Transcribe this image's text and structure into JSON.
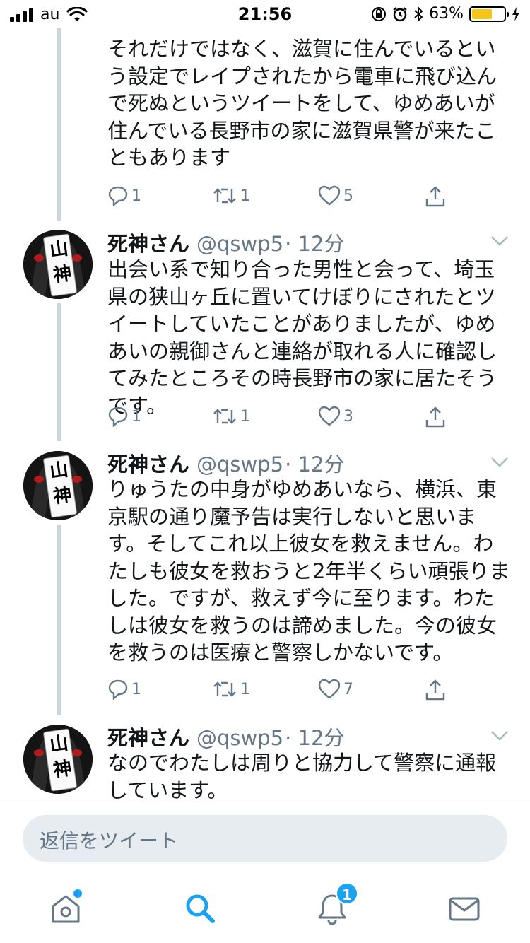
{
  "status_bar": {
    "carrier": "au",
    "time": "21:56",
    "battery_percent": "63%",
    "battery_level": 0.63
  },
  "tweets": [
    {
      "text": "それだけではなく、滋賀に住んでいるという設定でレイプされたから電車に飛び込んで死ぬというツイートをして、ゆめあいが住んでいる長野市の家に滋賀県警が来たこともあります",
      "replies": "1",
      "retweets": "1",
      "likes": "5"
    },
    {
      "name": "死神さん",
      "handle": "@qswp5",
      "time": "· 12分",
      "text": "出会い系で知り合った男性と会って、埼玉県の狭山ヶ丘に置いてけぼりにされたとツイートしていたことがありましたが、ゆめあいの親御さんと連絡が取れる人に確認してみたところその時長野市の家に居たそうです。",
      "replies": "1",
      "retweets": "1",
      "likes": "3"
    },
    {
      "name": "死神さん",
      "handle": "@qswp5",
      "time": "· 12分",
      "text": "りゅうたの中身がゆめあいなら、横浜、東京駅の通り魔予告は実行しないと思います。そしてこれ以上彼女を救えません。わたしも彼女を救おうと2年半くらい頑張りました。ですが、救えず今に至ります。わたしは彼女を救うのは諦めました。今の彼女を救うのは医療と警察しかないです。",
      "replies": "1",
      "retweets": "1",
      "likes": "7"
    },
    {
      "name": "死神さん",
      "handle": "@qswp5",
      "time": "· 12分",
      "text": "なのでわたしは周りと協力して警察に通報しています。"
    }
  ],
  "avatar": {
    "glyph_top": "山",
    "glyph_bottom": "神"
  },
  "reply_bar": {
    "placeholder": "返信をツイート"
  },
  "tab_bar": {
    "notifications_badge": "1",
    "accent_color": "#1da1f2"
  }
}
